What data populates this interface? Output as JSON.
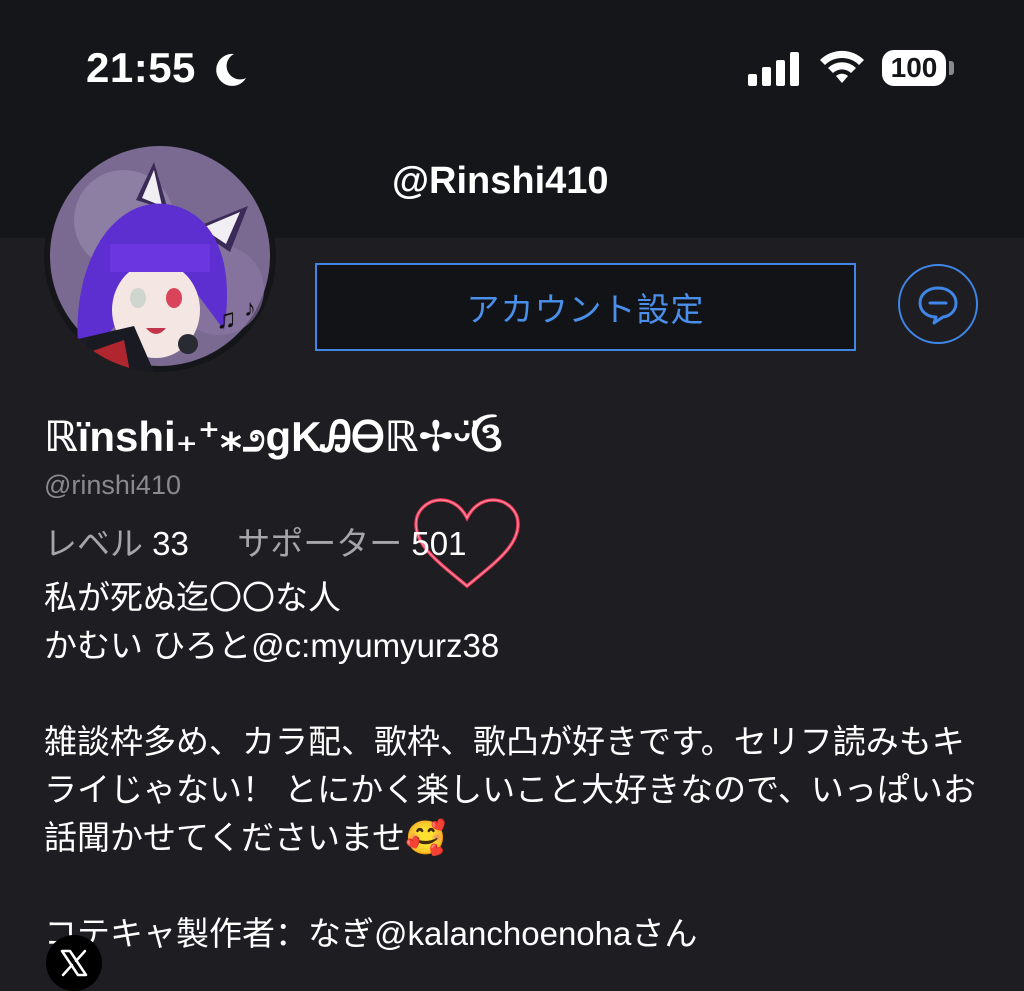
{
  "status_bar": {
    "time": "21:55",
    "battery": "100",
    "icons": [
      "moon-icon",
      "signal-icon",
      "wifi-icon",
      "battery-icon"
    ]
  },
  "profile": {
    "username_top": "@Rinshi410",
    "display_name": "ℝïnshi₊⁺⁎೨ɡKᎯᎾℝ✢ᵕ̈ઉ",
    "handle": "@rinshi410",
    "avatar_icon": "avatar-image"
  },
  "actions": {
    "account_settings": "アカウント設定",
    "chat_icon": "chat-bubble-icon"
  },
  "stats": {
    "level_label": "レベル",
    "level_value": "33",
    "supporters_label": "サポーター",
    "supporters_value": "501"
  },
  "bio": {
    "line1": "私が死ぬ迄〇〇な人",
    "line2": "かむい ひろと@c:myumyurz38",
    "para2": "雑談枠多め、カラ配、歌枠、歌凸が好きです。セリフ読みもキライじゃない！ とにかく楽しいこと大好きなので、いっぱいお話聞かせてくださいませ🥰",
    "para3": "コテキャ製作者：なぎ@kalanchoenohaさん"
  },
  "social": {
    "x_icon": "x-logo-icon"
  },
  "colors": {
    "background": "#1e1e22",
    "header": "#15161a",
    "accent": "#3f86e6",
    "heart": "#ff3b5c"
  }
}
